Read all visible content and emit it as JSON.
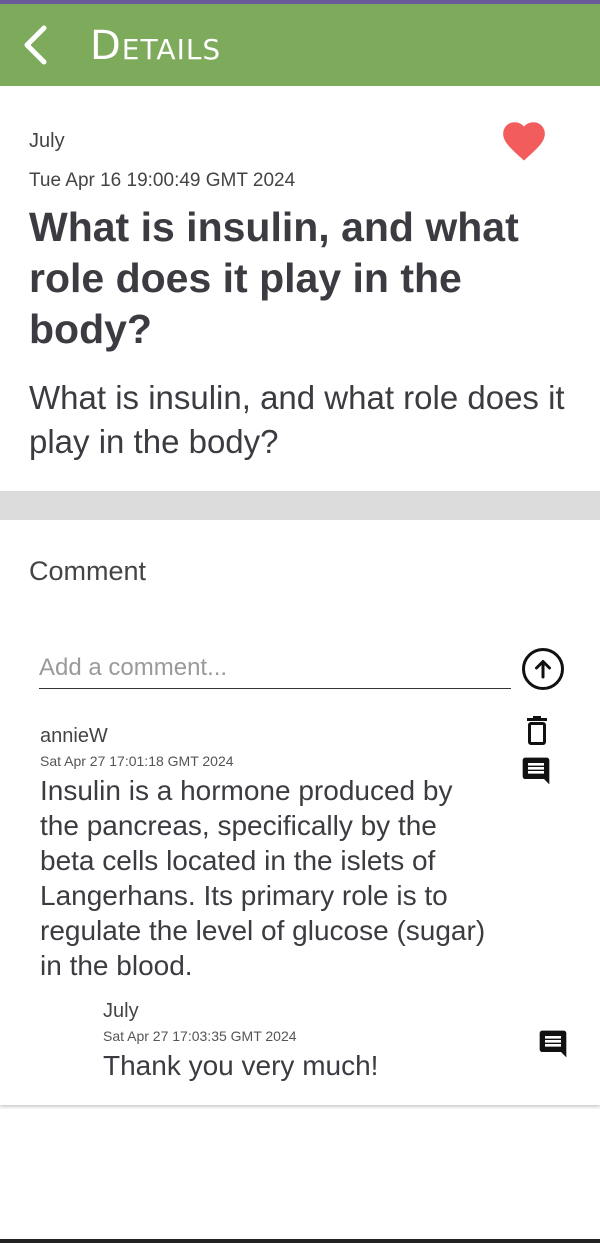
{
  "appbar": {
    "title": "Details",
    "back_icon": "chevron-left-icon",
    "color": "#7eaa5c"
  },
  "post": {
    "author": "July",
    "date": "Tue Apr 16 19:00:49 GMT 2024",
    "title": "What is insulin, and what role does it play in the body?",
    "body": "What is insulin, and what role does it play in the body?",
    "favorite_icon": "heart-icon",
    "favorite_color": "#f25c5c",
    "favorited": true
  },
  "comments": {
    "heading": "Comment",
    "input": {
      "value": "",
      "placeholder": "Add a comment..."
    },
    "send_icon": "arrow-up-circle-icon",
    "items": [
      {
        "author": "annieW",
        "date": "Sat Apr 27 17:01:18 GMT 2024",
        "text": "Insulin is a hormone produced by the pancreas, specifically by the beta cells located in the islets of Langerhans. Its primary role is to regulate the level of glucose (sugar) in the blood.",
        "icons": [
          "trash-icon",
          "comment-icon"
        ],
        "replies": [
          {
            "author": "July",
            "date": "Sat Apr 27 17:03:35 GMT 2024",
            "text": "Thank you very much!",
            "icons": [
              "comment-icon"
            ]
          }
        ]
      }
    ]
  }
}
